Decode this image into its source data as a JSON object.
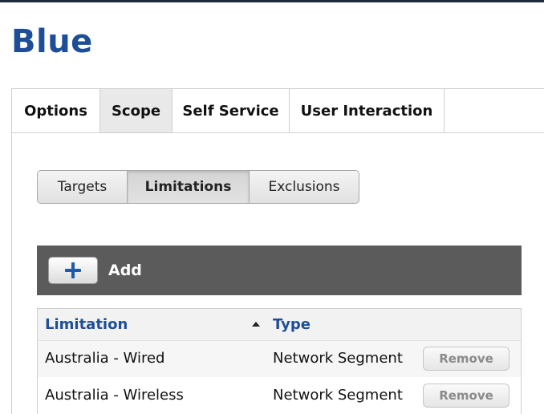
{
  "page": {
    "title": "Blue"
  },
  "main_tabs": [
    {
      "label": "Options",
      "active": false
    },
    {
      "label": "Scope",
      "active": true
    },
    {
      "label": "Self Service",
      "active": false
    },
    {
      "label": "User Interaction",
      "active": false
    }
  ],
  "sub_tabs": [
    {
      "label": "Targets",
      "active": false
    },
    {
      "label": "Limitations",
      "active": true
    },
    {
      "label": "Exclusions",
      "active": false
    }
  ],
  "add_bar": {
    "add_label": "Add",
    "add_icon": "plus-icon"
  },
  "table": {
    "columns": [
      {
        "label": "Limitation",
        "sorted": "ascending"
      },
      {
        "label": "Type"
      }
    ],
    "rows": [
      {
        "limitation": "Australia - Wired",
        "type": "Network Segment",
        "action": "Remove"
      },
      {
        "limitation": "Australia - Wireless",
        "type": "Network Segment",
        "action": "Remove"
      }
    ]
  },
  "colors": {
    "title_blue": "#1d4e96",
    "add_bar_bg": "#5b5b5b",
    "plus_blue": "#1f5aa6"
  }
}
